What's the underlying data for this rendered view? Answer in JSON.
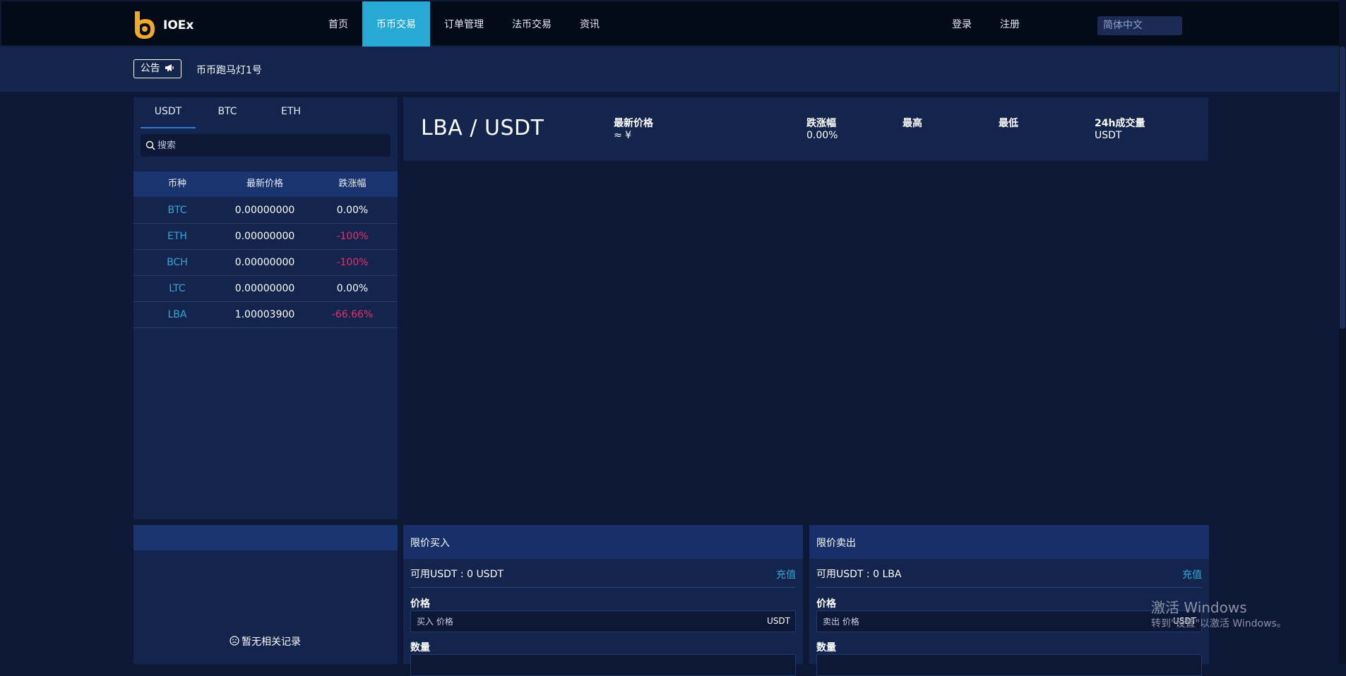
{
  "header": {
    "brand": "IOEx",
    "nav": [
      "首页",
      "币币交易",
      "订单管理",
      "法币交易",
      "资讯"
    ],
    "active_nav": "币币交易",
    "login": "登录",
    "register": "注册",
    "language": "简体中文"
  },
  "announcement": {
    "badge": "公告",
    "text": "币币跑马灯1号"
  },
  "market": {
    "tabs": [
      "USDT",
      "BTC",
      "ETH"
    ],
    "active_tab": "USDT",
    "search_placeholder": "搜索",
    "columns": [
      "币种",
      "最新价格",
      "跌涨幅"
    ],
    "rows": [
      {
        "coin": "BTC",
        "price": "0.00000000",
        "change": "0.00%"
      },
      {
        "coin": "ETH",
        "price": "0.00000000",
        "change": "-100%"
      },
      {
        "coin": "BCH",
        "price": "0.00000000",
        "change": "-100%"
      },
      {
        "coin": "LTC",
        "price": "0.00000000",
        "change": "0.00%"
      },
      {
        "coin": "LBA",
        "price": "1.00003900",
        "change": "-66.66%"
      }
    ]
  },
  "ticker": {
    "pair": "LBA / USDT",
    "latest_label": "最新价格",
    "latest_value": "≈ ¥",
    "change_label": "跌涨幅",
    "change_value": "0.00%",
    "high_label": "最高",
    "low_label": "最低",
    "volume_label": "24h成交量",
    "volume_value": "USDT"
  },
  "records": {
    "empty_text": "暂无相关记录"
  },
  "buy": {
    "title": "限价买入",
    "available": "可用USDT : 0 USDT",
    "recharge": "充值",
    "price_label": "价格",
    "price_placeholder": "买入 价格",
    "price_unit": "USDT",
    "qty_label": "数量"
  },
  "sell": {
    "title": "限价卖出",
    "available": "可用USDT : 0 LBA",
    "recharge": "充值",
    "price_label": "价格",
    "price_placeholder": "卖出 价格",
    "price_unit": "USDT",
    "qty_label": "数量"
  },
  "watermark": {
    "title": "激活 Windows",
    "subtitle": "转到\"设置\"以激活 Windows。"
  },
  "colors": {
    "accent": "#27a9d6",
    "negative": "#e8316c",
    "coin_link": "#33a8d8",
    "panel": "#13244d",
    "background": "#0d1836"
  }
}
